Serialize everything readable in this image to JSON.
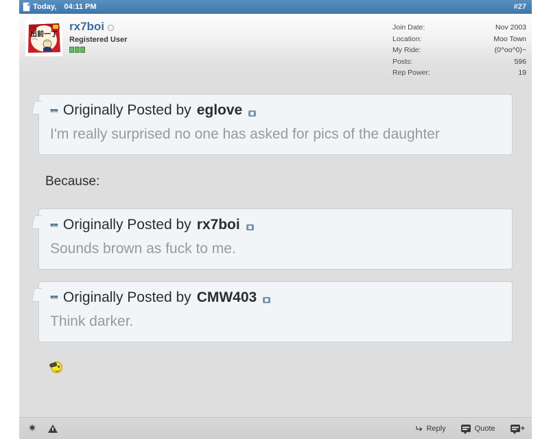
{
  "titlebar": {
    "doc_icon": "document-icon",
    "date": "Today,",
    "time": "04:11 PM",
    "post_number": "#27"
  },
  "user": {
    "avatar_alt": "instant-noodle-package-avatar",
    "avatar_text": "出前一丁",
    "name": "rx7boi",
    "online_status": "offline",
    "title": "Registered User",
    "rank_pips": 3,
    "stats": [
      {
        "label": "Join Date:",
        "value": "Nov 2003"
      },
      {
        "label": "Location:",
        "value": "Moo Town"
      },
      {
        "label": "My Ride:",
        "value": "(0^oo^0)~"
      },
      {
        "label": "Posts:",
        "value": "596"
      },
      {
        "label": "Rep Power:",
        "value": "19"
      }
    ]
  },
  "body": {
    "quote1": {
      "prefix": "Originally Posted by",
      "author": "eglove",
      "text": "I'm really surprised no one has asked for pics of the daughter"
    },
    "interjection": "Because:",
    "quote2": {
      "prefix": "Originally Posted by",
      "author": "rx7boi",
      "text": "Sounds brown as fuck to me."
    },
    "quote3": {
      "prefix": "Originally Posted by",
      "author": "CMW403",
      "text": "Think darker."
    },
    "smiley": "sunglasses-smiley-emoticon"
  },
  "footer": {
    "star_icon": "star-icon",
    "warn_icon": "report-warning-icon",
    "reply_label": "Reply",
    "quote_label": "Quote",
    "multiquote_icon": "multi-quote-icon"
  },
  "colors": {
    "titlebar": "#4b82b4",
    "username": "#3b6e9c",
    "page_bg": "#dedede",
    "quote_bg": "#f2f5f8",
    "quote_border": "#c9d0d6",
    "quote_text": "#949a9e",
    "rank_green": "#63b863"
  }
}
